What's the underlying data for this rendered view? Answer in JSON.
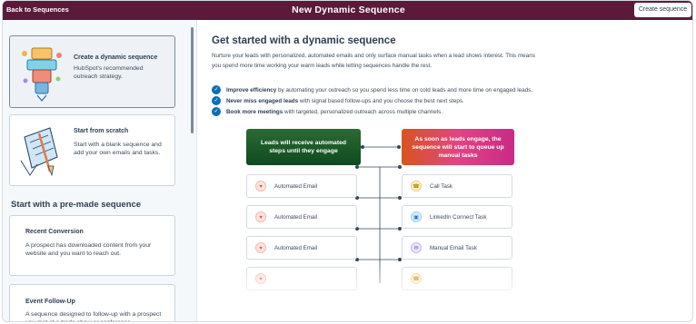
{
  "header": {
    "back_label": "Back to Sequences",
    "title": "New Dynamic Sequence",
    "create_label": "Create sequence"
  },
  "sidebar": {
    "cards": [
      {
        "title": "Create a dynamic sequence",
        "description": "HubSpot's recommended outreach strategy."
      },
      {
        "title": "Start from scratch",
        "description": "Start with a blank sequence and add your own emails and tasks."
      }
    ],
    "premade_heading": "Start with a pre-made sequence",
    "premade": [
      {
        "title": "Recent Conversion",
        "description": "A prospect has downloaded content from your website and you want to reach out."
      },
      {
        "title": "Event Follow-Up",
        "description": "A sequence designed to follow-up with a prospect you met at a trade show or conference"
      }
    ]
  },
  "main": {
    "title": "Get started with a dynamic sequence",
    "intro": "Nurture your leads with personalized, automated emails and only surface manual tasks when a lead shows interest. This means you spend more time working your warm leads while letting sequences handle the rest.",
    "bullets": [
      {
        "bold": "Improve efficiency",
        "text": " by automating your outreach so you spend less time on cold leads and more time on engaged leads."
      },
      {
        "bold": "Never miss engaged leads",
        "text": " with signal based follow-ups and you choose the best next steps."
      },
      {
        "bold": "Book more meetings",
        "text": " with targeted, personalized outreach across multiple channels."
      }
    ],
    "diagram": {
      "left_header": "Leads will receive automated steps until they engage",
      "right_header": "As soon as leads engage, the sequence will start to queue up manual tasks",
      "left_tasks": [
        "Automated Email",
        "Automated Email",
        "Automated Email"
      ],
      "right_tasks": [
        {
          "label": "Call Task",
          "icon": "phone-icon"
        },
        {
          "label": "LinkedIn Connect Task",
          "icon": "linkedin-icon"
        },
        {
          "label": "Manual Email Task",
          "icon": "envelope-icon"
        },
        {
          "label": "",
          "icon": "phone-icon"
        }
      ]
    }
  },
  "colors": {
    "header_bg": "#5b1a3a",
    "check_blue": "#0b6fb6",
    "green_header": "#1f5c2b",
    "orange_header": "#e2553a",
    "pink_header": "#d13a8a"
  }
}
